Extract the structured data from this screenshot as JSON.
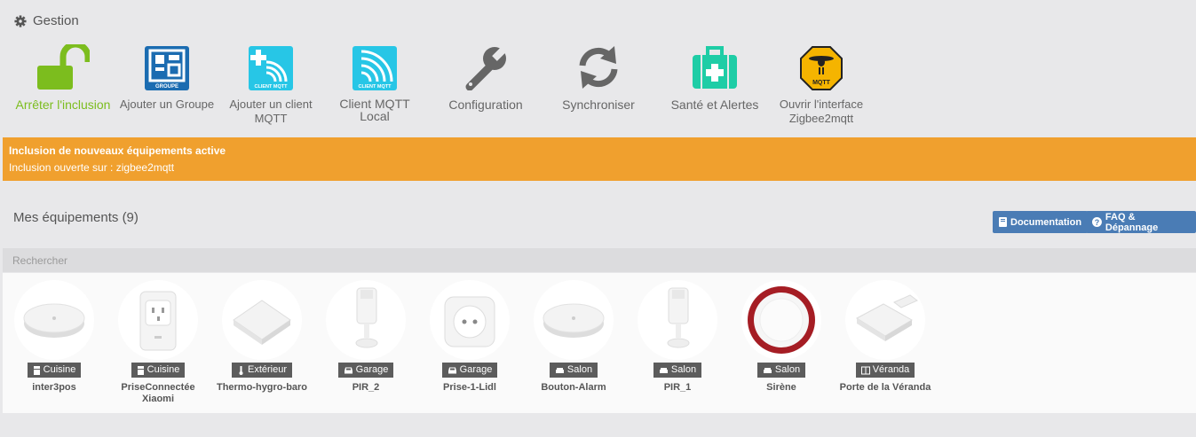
{
  "section": {
    "title": "Gestion"
  },
  "actions": [
    {
      "label": "Arrêter l'inclusion",
      "icon": "unlock-icon"
    },
    {
      "label": "Ajouter un Groupe",
      "icon": "group-icon",
      "badge": "GROUPE"
    },
    {
      "label": "Ajouter un client MQTT",
      "icon": "mqtt-client-add-icon",
      "badge": "CLIENT MQTT"
    },
    {
      "label": "Client MQTT Local",
      "icon": "mqtt-client-local-icon",
      "badge": "CLIENT MQTT"
    },
    {
      "label": "Configuration",
      "icon": "wrench-icon"
    },
    {
      "label": "Synchroniser",
      "icon": "sync-icon"
    },
    {
      "label": "Santé et Alertes",
      "icon": "medical-kit-icon"
    },
    {
      "label": "Ouvrir l'interface Zigbee2mqtt",
      "icon": "zigbee2mqtt-icon",
      "badge": "MQTT"
    }
  ],
  "banner": {
    "title": "Inclusion de nouveaux équipements active",
    "subtitle": "Inclusion ouverte sur : zigbee2mqtt"
  },
  "equipments": {
    "title": "Mes équipements (9)",
    "doc_button": "Documentation",
    "faq_button": "FAQ & Dépannage",
    "search_placeholder": "Rechercher",
    "items": [
      {
        "room": "Cuisine",
        "name": "inter3pos",
        "device": "button"
      },
      {
        "room": "Cuisine",
        "name": "PriseConnectée Xiaomi",
        "device": "plug-xiaomi"
      },
      {
        "room": "Extérieur",
        "name": "Thermo-hygro-baro",
        "device": "sensor"
      },
      {
        "room": "Garage",
        "name": "PIR_2",
        "device": "pir"
      },
      {
        "room": "Garage",
        "name": "Prise-1-Lidl",
        "device": "plug-eu"
      },
      {
        "room": "Salon",
        "name": "Bouton-Alarm",
        "device": "button"
      },
      {
        "room": "Salon",
        "name": "PIR_1",
        "device": "pir"
      },
      {
        "room": "Salon",
        "name": "Sirène",
        "device": "siren"
      },
      {
        "room": "Véranda",
        "name": "Porte de la Véranda",
        "device": "door"
      }
    ]
  },
  "colors": {
    "active_green": "#7cbd1e",
    "banner_orange": "#f0a02e",
    "button_blue": "#4a7cb5",
    "room_tag": "#5c5c5c",
    "mqtt_cyan": "#27c6e6",
    "group_blue": "#1b6cb1",
    "health_teal": "#1ecda6"
  }
}
